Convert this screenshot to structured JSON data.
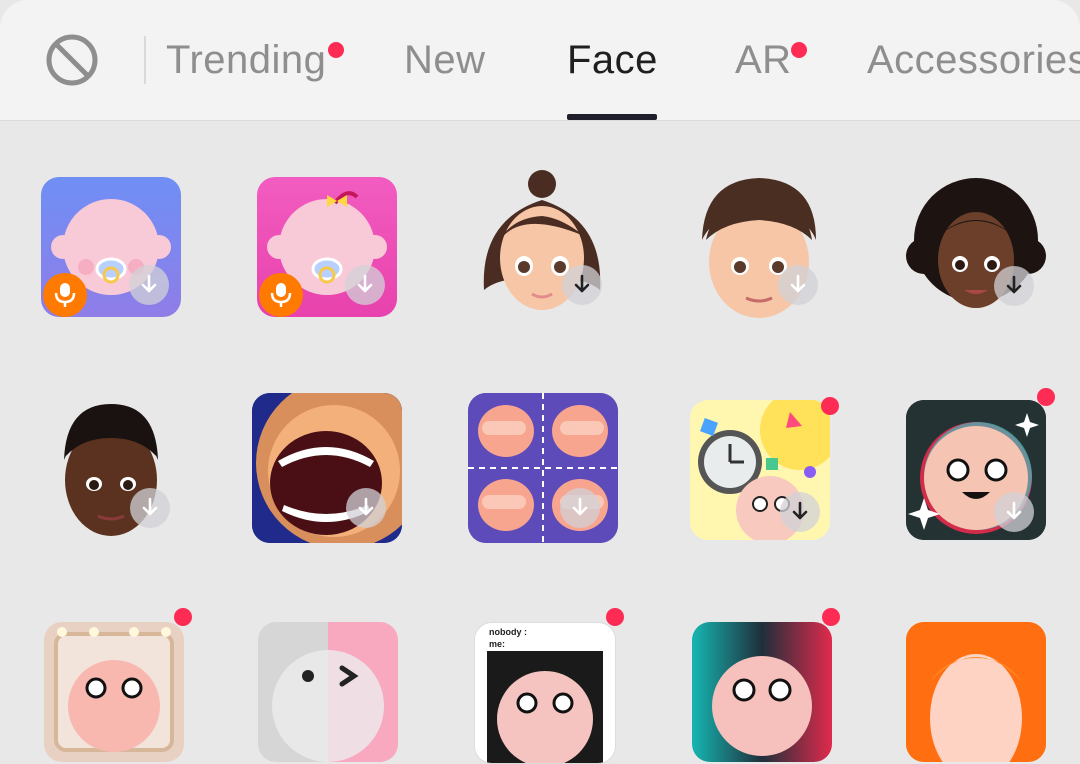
{
  "tabs": {
    "items": [
      {
        "label": "Trending",
        "has_dot": true
      },
      {
        "label": "New",
        "has_dot": false
      },
      {
        "label": "Face",
        "has_dot": false,
        "active": true
      },
      {
        "label": "AR",
        "has_dot": true
      },
      {
        "label": "Accessories",
        "has_dot": false
      }
    ],
    "no_effect_icon": "no-effect-icon"
  },
  "colors": {
    "accent_dot": "#fe2c55",
    "active_tab": "#1f1f1f",
    "inactive_tab": "#8e8e8e",
    "mic_badge": "#ff7a00",
    "background": "#e8e8e8"
  },
  "effects": [
    {
      "name": "baby-face-blue",
      "badge": "microphone",
      "downloadable": true,
      "is_new": false
    },
    {
      "name": "baby-face-pink",
      "badge": "microphone",
      "downloadable": true,
      "is_new": false
    },
    {
      "name": "avatar-girl-bun",
      "badge": "",
      "downloadable": true,
      "is_new": false
    },
    {
      "name": "avatar-boy-brown-hair",
      "badge": "",
      "downloadable": true,
      "is_new": false
    },
    {
      "name": "avatar-woman-curly",
      "badge": "",
      "downloadable": true,
      "is_new": false
    },
    {
      "name": "avatar-man-dark",
      "badge": "",
      "downloadable": true,
      "is_new": false
    },
    {
      "name": "big-mouth",
      "badge": "",
      "downloadable": true,
      "is_new": false
    },
    {
      "name": "face-grid-hands",
      "badge": "",
      "downloadable": true,
      "is_new": false
    },
    {
      "name": "clock-confetti",
      "badge": "",
      "downloadable": true,
      "is_new": true
    },
    {
      "name": "sparkle-face",
      "badge": "",
      "downloadable": true,
      "is_new": true
    },
    {
      "name": "mirror-lights",
      "badge": "",
      "downloadable": false,
      "is_new": true
    },
    {
      "name": "wink-face",
      "badge": "",
      "downloadable": false,
      "is_new": false
    },
    {
      "name": "nobody-me-meme",
      "badge": "",
      "downloadable": false,
      "is_new": true
    },
    {
      "name": "teal-red-face",
      "badge": "",
      "downloadable": false,
      "is_new": true
    },
    {
      "name": "orange-hair",
      "badge": "",
      "downloadable": false,
      "is_new": false
    }
  ],
  "meme_text": {
    "line1": "nobody :",
    "line2": "me:"
  }
}
